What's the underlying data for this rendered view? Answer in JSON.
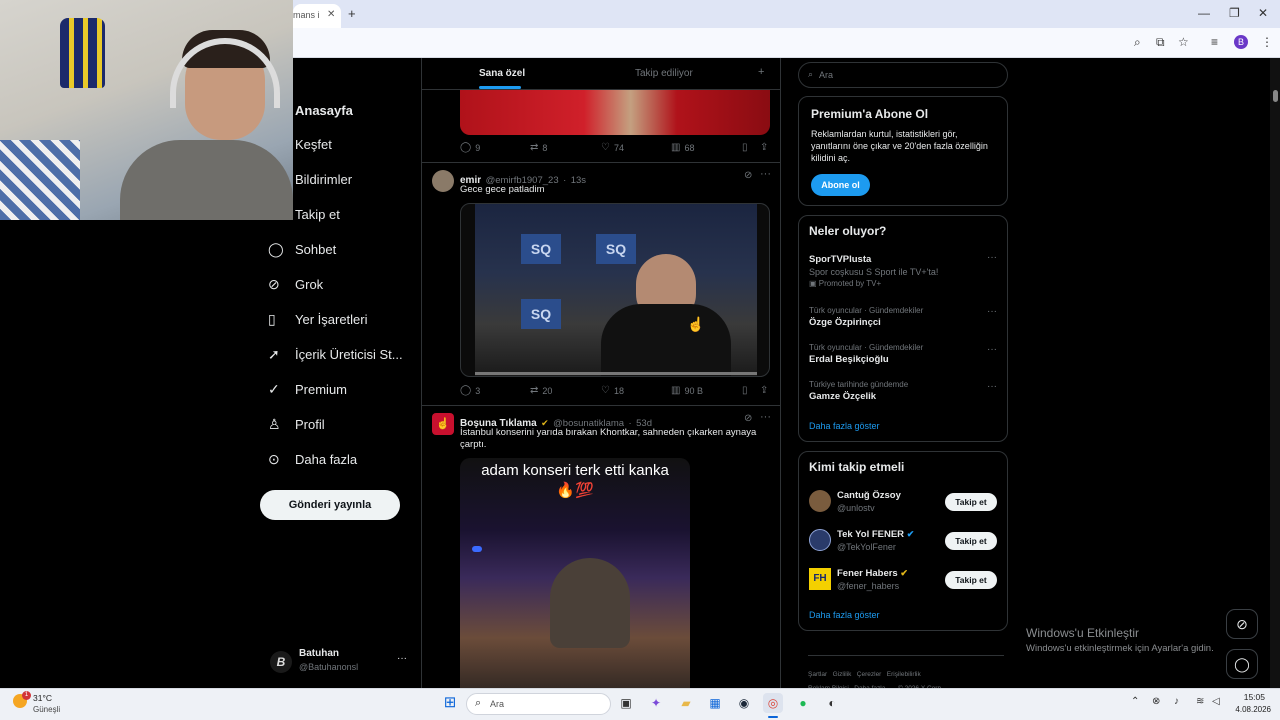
{
  "browser": {
    "tab_title": "mans i",
    "new_tab_icon": "+",
    "window_controls": [
      "—",
      "❐",
      "✕"
    ],
    "profile_initial": "B"
  },
  "nav": {
    "items": [
      {
        "label": "Anasayfa",
        "icon": "home-icon",
        "bold": true
      },
      {
        "label": "Keşfet",
        "icon": "search-icon"
      },
      {
        "label": "Bildirimler",
        "icon": "bell-icon"
      },
      {
        "label": "Takip et",
        "icon": "follow-icon"
      },
      {
        "label": "Sohbet",
        "icon": "chat-icon"
      },
      {
        "label": "Grok",
        "icon": "grok-icon"
      },
      {
        "label": "Yer İşaretleri",
        "icon": "bookmark-icon"
      },
      {
        "label": "İçerik Üreticisi St...",
        "icon": "rocket-icon"
      },
      {
        "label": "Premium",
        "icon": "verified-icon"
      },
      {
        "label": "Profil",
        "icon": "profile-icon"
      },
      {
        "label": "Daha fazla",
        "icon": "more-icon"
      }
    ],
    "post_button": "Gönderi yayınla",
    "account": {
      "name": "Batuhan",
      "handle": "@Batuhanonsl"
    }
  },
  "feed": {
    "tabs": [
      "Sana özel",
      "Takip ediliyor"
    ],
    "tweet1_actions": {
      "replies": "9",
      "retweets": "8",
      "likes": "74",
      "views": "68"
    },
    "tweet2": {
      "name": "emir",
      "handle": "@emirfb1907_23",
      "time": "13s",
      "text": "Gece gece patladim",
      "actions": {
        "replies": "3",
        "retweets": "20",
        "likes": "18",
        "views": "90 B"
      }
    },
    "tweet3": {
      "name": "Boşuna Tıklama",
      "handle": "@bosunatiklama",
      "time": "53d",
      "text": "İstanbul konserini yarıda bırakan Khontkar, sahneden çıkarken aynaya çarptı.",
      "media_caption": "adam konseri terk etti kanka 🔥💯"
    }
  },
  "sidebar": {
    "search_placeholder": "Ara",
    "premium": {
      "title": "Premium'a Abone Ol",
      "text": "Reklamlardan kurtul, istatistikleri gör, yanıtlarını öne çıkar ve 20'den fazla özelliğin kilidini aç.",
      "button": "Abone ol"
    },
    "trends": {
      "title": "Neler oluyor?",
      "items": [
        {
          "context": "",
          "title": "SporTVPlusta",
          "sub": "Spor coşkusu S Sport ile TV+'ta!",
          "promo": "Promoted by TV+"
        },
        {
          "context": "Türk oyuncular · Gündemdekiler",
          "title": "Özge Özpirinçci"
        },
        {
          "context": "Türk oyuncular · Gündemdekiler",
          "title": "Erdal Beşikçioğlu"
        },
        {
          "context": "Türkiye tarihinde gündemde",
          "title": "Gamze Özçelik"
        }
      ],
      "show_more": "Daha fazla göster"
    },
    "who_to_follow": {
      "title": "Kimi takip etmeli",
      "items": [
        {
          "name": "Cantuğ Özsoy",
          "handle": "@unlostv",
          "button": "Takip et"
        },
        {
          "name": "Tek Yol FENER",
          "handle": "@TekYolFener",
          "button": "Takip et"
        },
        {
          "name": "Fener Habers",
          "handle": "@fener_habers",
          "button": "Takip et"
        }
      ],
      "show_more": "Daha fazla göster"
    },
    "footer": [
      "Şartlar",
      "Gizlilik",
      "Çerezler",
      "Erişilebilirlik",
      "Reklam Bilgisi",
      "Daha fazla ...",
      "© 2026 X Corp."
    ]
  },
  "windows": {
    "watermark_title": "Windows'u Etkinleştir",
    "watermark_text": "Windows'u etkinleştirmek için Ayarlar'a gidin.",
    "weather": {
      "temp": "31°C",
      "desc": "Güneşli",
      "badge": "1"
    },
    "search": "Ara",
    "clock": {
      "time": "15:05",
      "date": "4.08.2026"
    }
  }
}
